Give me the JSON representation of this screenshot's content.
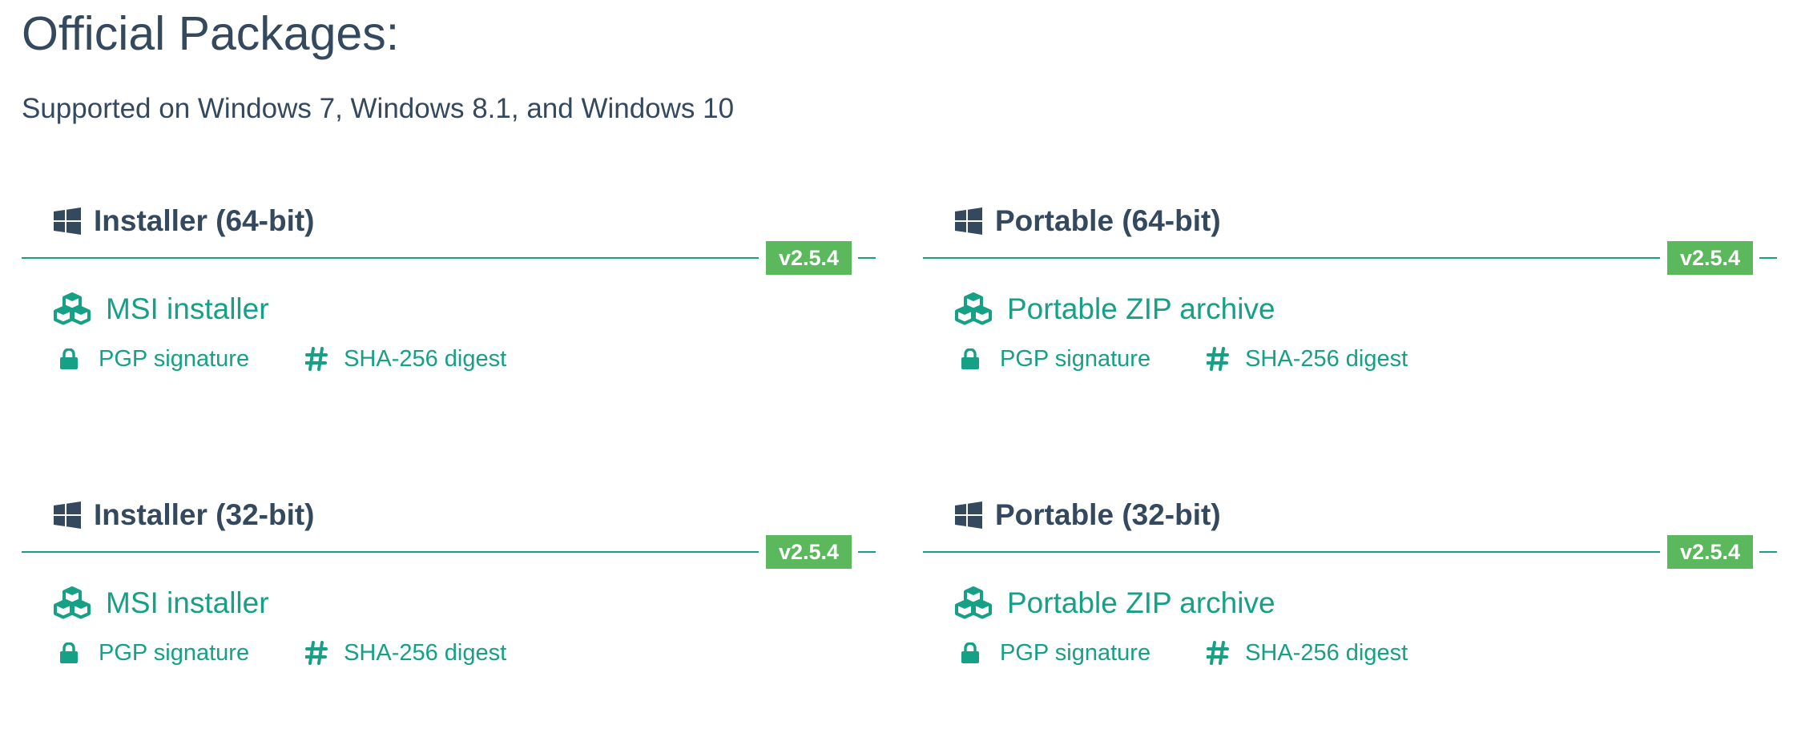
{
  "heading": "Official Packages:",
  "subheading": "Supported on Windows 7, Windows 8.1, and Windows 10",
  "colors": {
    "text": "#34495e",
    "accent": "#16a085",
    "badge": "#5cb85c"
  },
  "packages": [
    {
      "title": "Installer (64-bit)",
      "version": "v2.5.4",
      "main_label": "MSI installer",
      "pgp_label": "PGP signature",
      "sha_label": "SHA-256 digest"
    },
    {
      "title": "Portable (64-bit)",
      "version": "v2.5.4",
      "main_label": "Portable ZIP archive",
      "pgp_label": "PGP signature",
      "sha_label": "SHA-256 digest"
    },
    {
      "title": "Installer (32-bit)",
      "version": "v2.5.4",
      "main_label": "MSI installer",
      "pgp_label": "PGP signature",
      "sha_label": "SHA-256 digest"
    },
    {
      "title": "Portable (32-bit)",
      "version": "v2.5.4",
      "main_label": "Portable ZIP archive",
      "pgp_label": "PGP signature",
      "sha_label": "SHA-256 digest"
    }
  ],
  "icons": {
    "header": "windows-icon",
    "main": "cubes-icon",
    "pgp": "lock-icon",
    "sha": "hash-icon"
  }
}
